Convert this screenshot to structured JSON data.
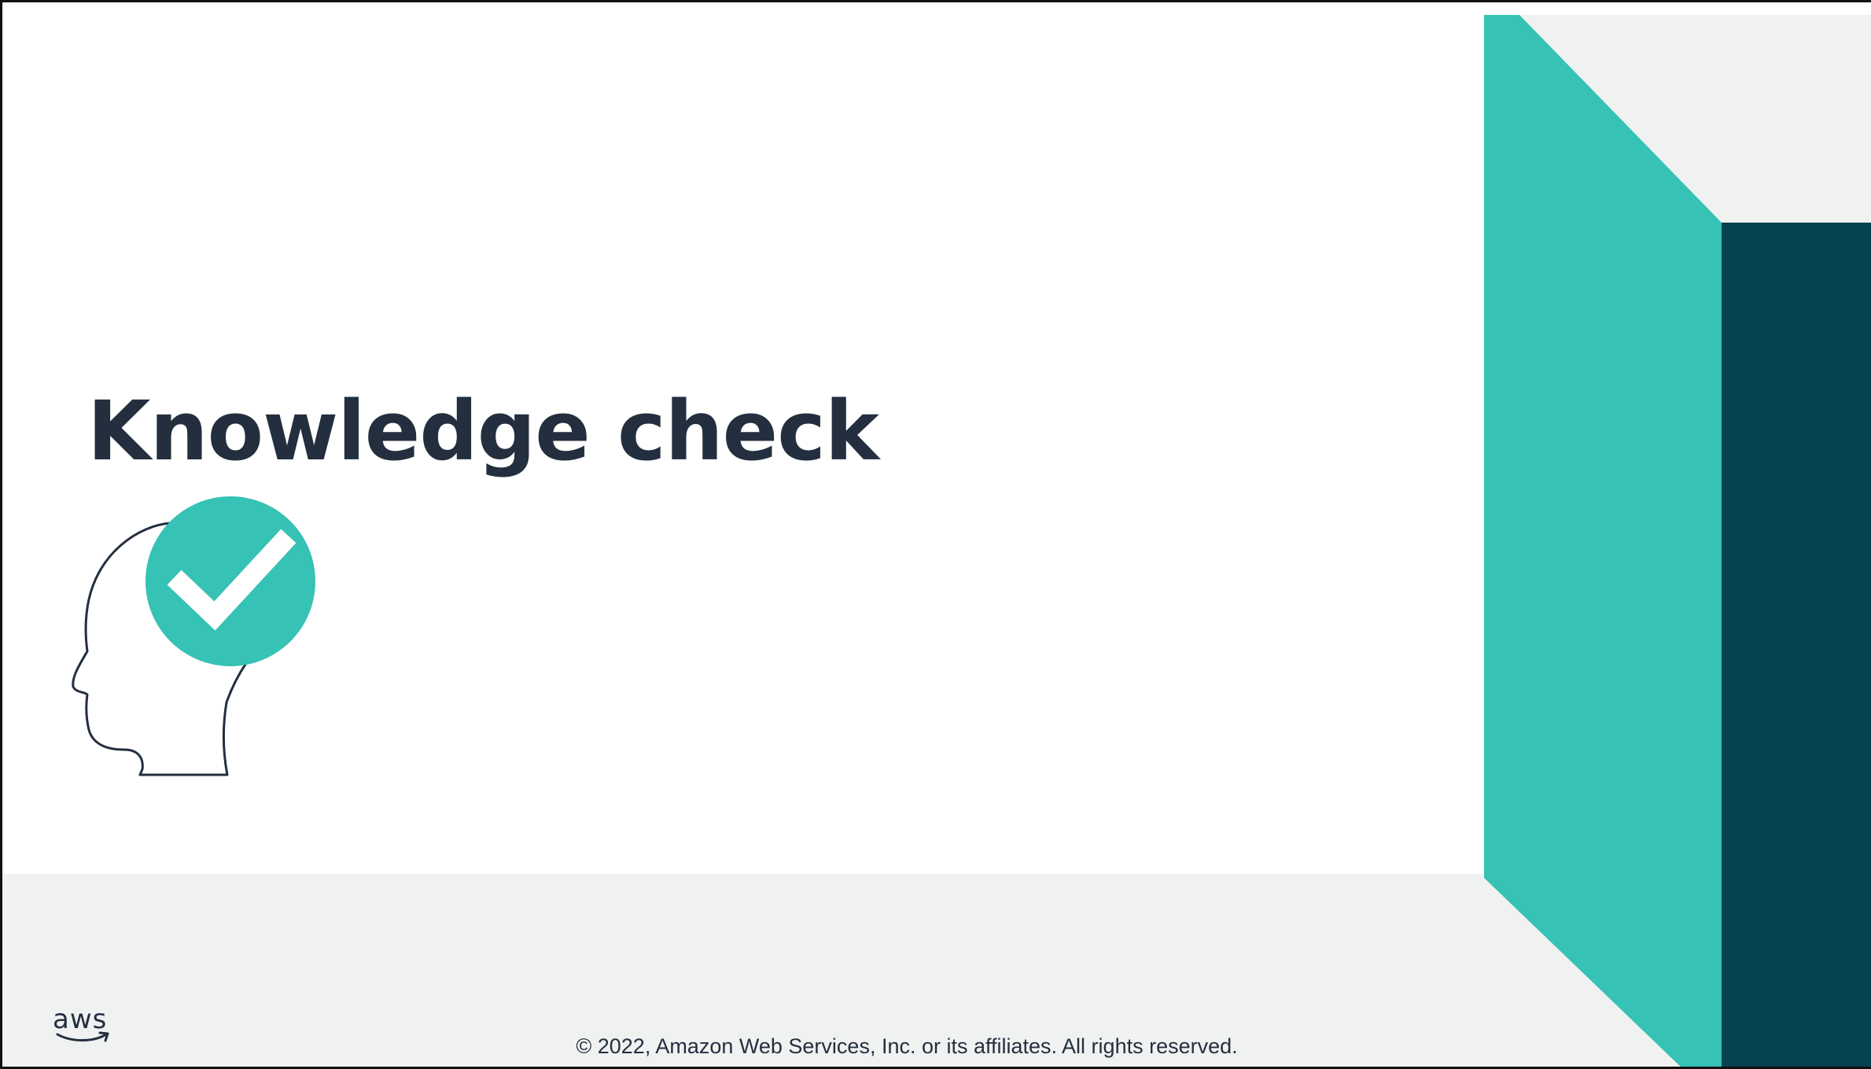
{
  "slide": {
    "title": "Knowledge check",
    "footer": {
      "copyright": "© 2022, Amazon Web Services, Inc. or its affiliates. All rights reserved.",
      "logo_text": "aws"
    },
    "icons": {
      "illustration": "head-with-checkmark-icon",
      "logo": "aws-logo-icon"
    }
  },
  "colors": {
    "title_text": "#232f3e",
    "teal": "#36c2b4",
    "dark_teal": "#06434f",
    "light_gray": "#f0f1f1",
    "white": "#ffffff"
  }
}
